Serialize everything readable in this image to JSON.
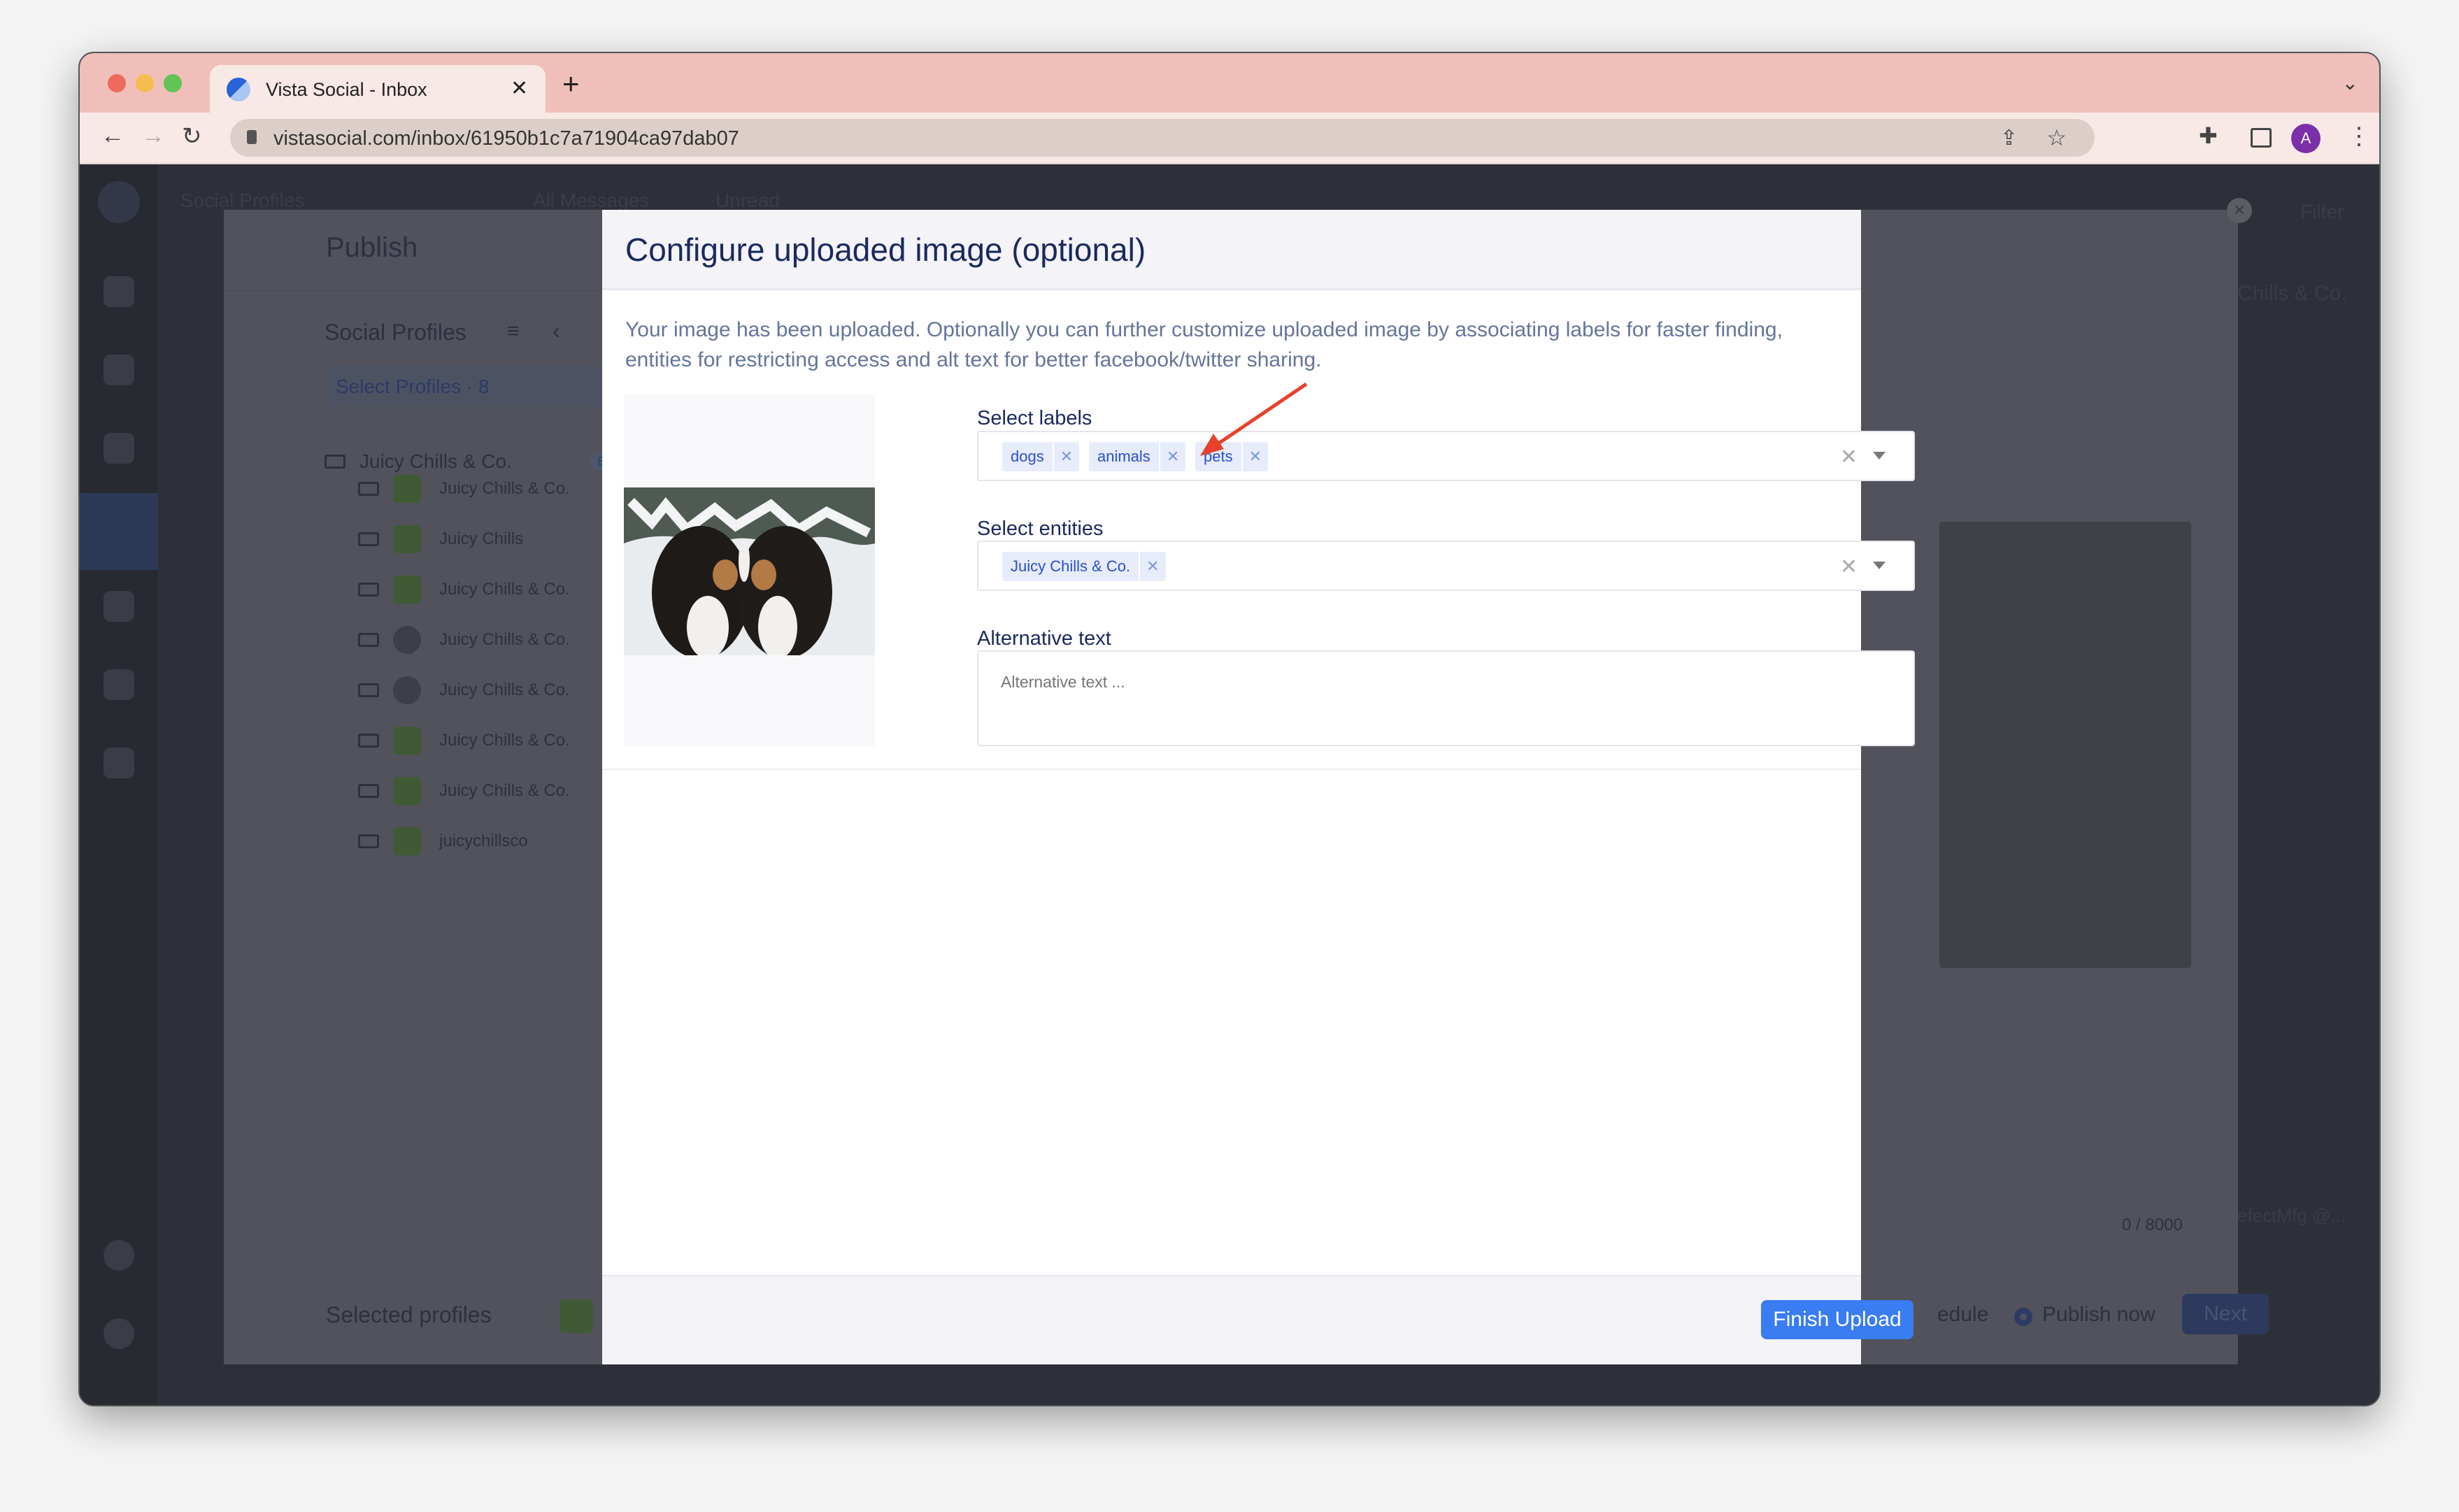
{
  "browser": {
    "tab_title": "Vista Social - Inbox",
    "url": "vistasocial.com/inbox/61950b1c7a71904ca97dab07",
    "new_tab_icon": "plus-icon",
    "profile_initial": "A"
  },
  "background": {
    "top_bar": {
      "social_profiles": "Social Profiles",
      "all_messages": "All Messages",
      "unread": "Unread",
      "filter": "Filter"
    },
    "right_text": "Chills & Co.",
    "right_bottom_text": "efectMfg @...",
    "publish": {
      "title": "Publish",
      "social_profiles_heading": "Social Profiles",
      "select_profiles": "Select Profiles · 8",
      "group": {
        "name": "Juicy Chills & Co.",
        "count": "8"
      },
      "profiles": [
        {
          "name": "Juicy Chills & Co.",
          "network": "facebook"
        },
        {
          "name": "Juicy Chills",
          "network": "facebook"
        },
        {
          "name": "Juicy Chills & Co.",
          "network": "linkedin"
        },
        {
          "name": "Juicy Chills & Co.",
          "network": "google"
        },
        {
          "name": "Juicy Chills & Co.",
          "network": "instagram"
        },
        {
          "name": "Juicy Chills & Co.",
          "network": "twitter"
        },
        {
          "name": "Juicy Chills & Co.",
          "network": "youtube"
        },
        {
          "name": "juicychillsco",
          "network": "reddit"
        }
      ],
      "selected_profiles": "Selected profiles",
      "char_count": "0 / 8000",
      "schedule": "edule",
      "publish_now": "Publish now",
      "next": "Next"
    }
  },
  "modal": {
    "title": "Configure uploaded image (optional)",
    "description": "Your image has been uploaded. Optionally you can further customize uploaded image by associating labels for faster finding, entities for restricting access and alt text for better facebook/twitter sharing.",
    "labels": {
      "label": "Select labels",
      "chips": [
        "dogs",
        "animals",
        "pets"
      ]
    },
    "entities": {
      "label": "Select entities",
      "chips": [
        "Juicy Chills & Co."
      ]
    },
    "alt_text": {
      "label": "Alternative text",
      "placeholder": "Alternative text ...",
      "value": ""
    },
    "finish_button": "Finish Upload"
  },
  "colors": {
    "accent": "#3a7cf1",
    "chip_bg": "#e6ecfa",
    "annotation_arrow": "#e8412c",
    "tab_bar": "#f0bfb9"
  }
}
